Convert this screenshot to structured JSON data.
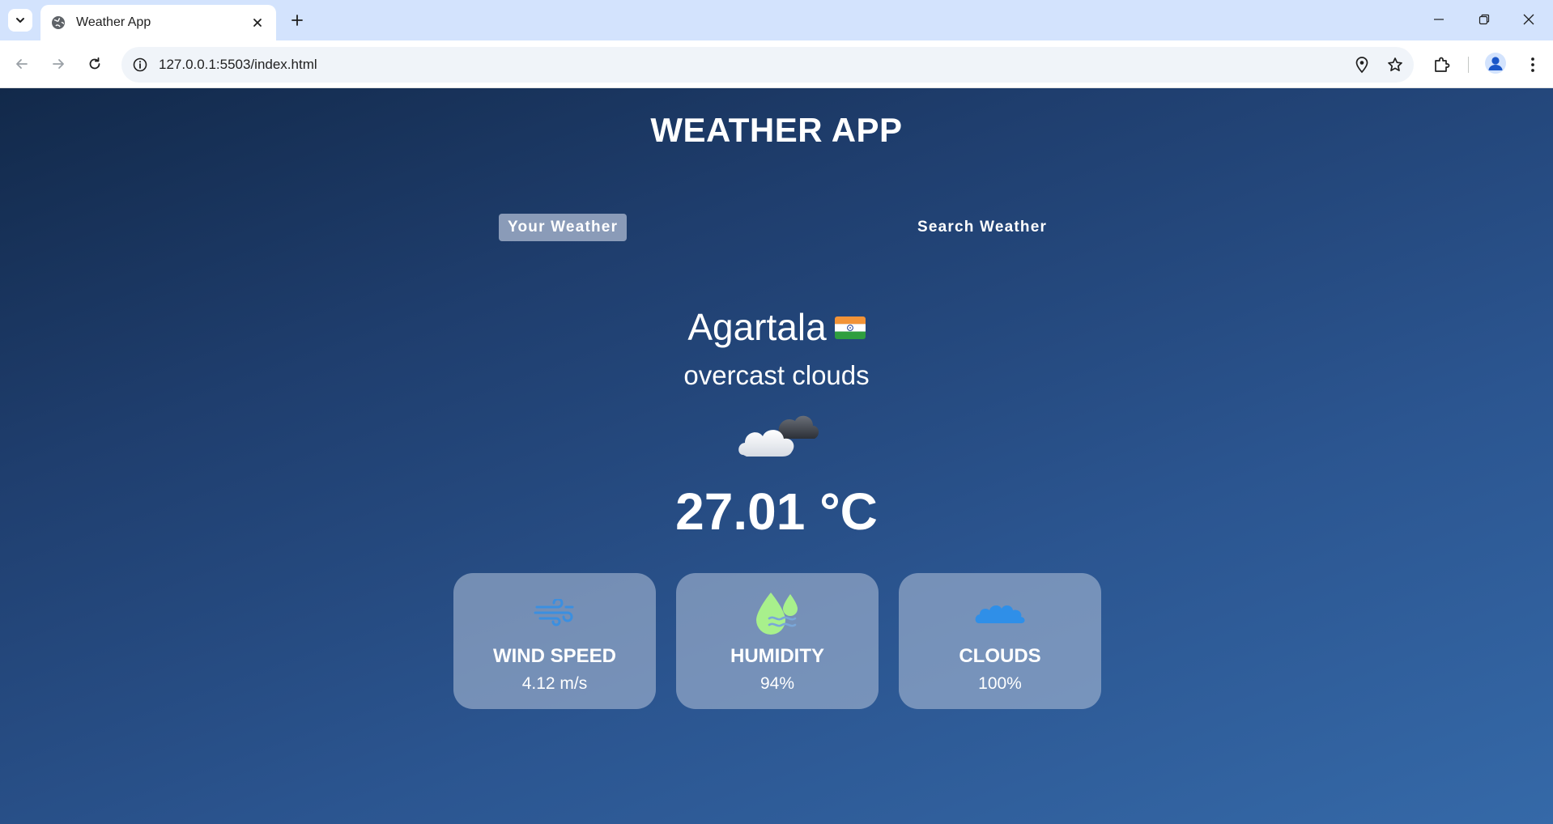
{
  "browser": {
    "tab": {
      "title": "Weather App",
      "favicon": "globe-icon"
    },
    "url": "127.0.0.1:5503/index.html",
    "icons": {
      "tab_search": "chevron-down-icon",
      "new_tab": "plus-icon",
      "back": "back-arrow-icon",
      "forward": "forward-arrow-icon",
      "reload": "reload-icon",
      "site_info": "info-icon",
      "location": "location-pin-icon",
      "bookmark": "star-icon",
      "extensions": "puzzle-icon",
      "profile": "avatar-icon",
      "menu": "kebab-menu-icon"
    }
  },
  "app": {
    "title": "WEATHER APP",
    "tabs": [
      {
        "label": "Your Weather",
        "active": true
      },
      {
        "label": "Search Weather",
        "active": false
      }
    ],
    "city": "Agartala",
    "country_flag": "india-flag-icon",
    "description": "overcast clouds",
    "weather_icon": "broken-clouds-icon",
    "temperature": "27.01 °C",
    "cards": [
      {
        "label": "WIND SPEED",
        "value": "4.12 m/s",
        "icon": "wind-icon"
      },
      {
        "label": "HUMIDITY",
        "value": "94%",
        "icon": "humidity-drops-icon"
      },
      {
        "label": "CLOUDS",
        "value": "100%",
        "icon": "cloud-icon"
      }
    ]
  },
  "colors": {
    "bg_top": "#12294a",
    "bg_bottom": "#3569a8",
    "card_bg": "#a5b6d2",
    "active_tab_bg": "#8a9bb8",
    "wind_icon": "#3b8fe0",
    "humidity_icon": "#a8f08c",
    "cloud_icon": "#2f8fe8"
  }
}
